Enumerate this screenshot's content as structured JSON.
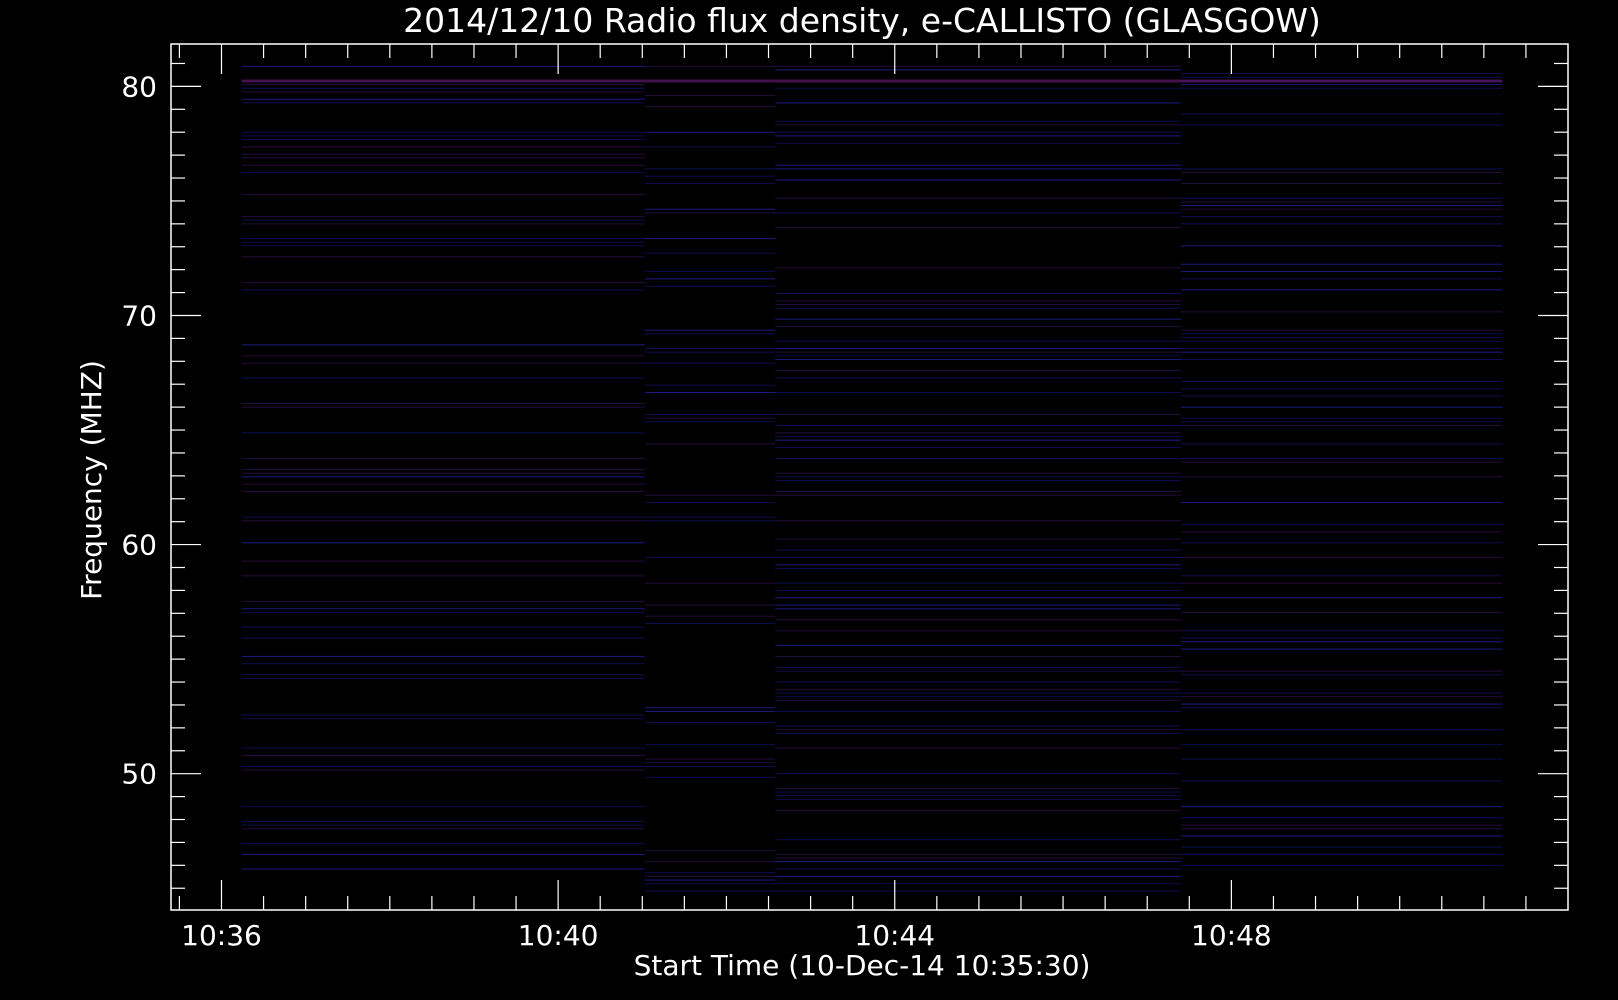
{
  "chart_data": {
    "type": "heatmap",
    "title": "2014/12/10  Radio flux density, e-CALLISTO (GLASGOW)",
    "xlabel": "Start Time (10-Dec-14 10:35:30)",
    "ylabel": "Frequency (MHZ)",
    "x_unit": "minutes after 10:35:30",
    "xlim": [
      -0.1,
      16.5
    ],
    "ylim": [
      81.85,
      44.05
    ],
    "data_xlim": [
      0.74,
      15.72
    ],
    "data_ylim": [
      44.9,
      80.95
    ],
    "x_ticks": [
      {
        "label": "10:36",
        "value": 0.5
      },
      {
        "label": "10:40",
        "value": 4.5
      },
      {
        "label": "10:44",
        "value": 8.5
      },
      {
        "label": "10:48",
        "value": 12.5
      }
    ],
    "y_ticks": [
      {
        "label": "50",
        "value": 50
      },
      {
        "label": "60",
        "value": 60
      },
      {
        "label": "70",
        "value": 70
      },
      {
        "label": "80",
        "value": 80
      }
    ],
    "colors": {
      "background": "#000000",
      "base": "#2828f4",
      "low": "#0a0a6e",
      "medium": "#8a1f6a",
      "high": "#e81f1f",
      "very_high": "#ffe040",
      "saturated": "#ffffb0"
    },
    "segments": [
      {
        "start": 0.74,
        "end": 5.53,
        "base": "#2b2bf2",
        "bands": [
          {
            "f": 45.2,
            "w": 0.45,
            "c": "#e82010"
          },
          {
            "f": 47.4,
            "w": 0.5,
            "c": "#d82020",
            "pulsed": true
          },
          {
            "f": 48.0,
            "w": 0.7,
            "c": "#000000"
          },
          {
            "f": 48.8,
            "w": 0.35,
            "c": "#ffffb0"
          },
          {
            "f": 49.35,
            "w": 0.3,
            "c": "#000000"
          },
          {
            "f": 49.7,
            "w": 0.5,
            "c": "#ffe040",
            "pulsed": true
          },
          {
            "f": 50.6,
            "w": 0.3,
            "c": "#c81c2c"
          },
          {
            "f": 51.5,
            "w": 0.45,
            "c": "#e81f1f"
          },
          {
            "f": 52.6,
            "w": 0.35,
            "c": "#d21f24"
          },
          {
            "f": 53.6,
            "w": 0.3,
            "c": "#7a1f6a"
          },
          {
            "f": 56.5,
            "w": 0.25,
            "c": "#6a1f7a"
          },
          {
            "f": 58.9,
            "w": 0.4,
            "c": "#10105a"
          },
          {
            "f": 59.4,
            "w": 0.4,
            "c": "#c81c28"
          },
          {
            "f": 63.9,
            "w": 0.3,
            "c": "#0a0a6e"
          },
          {
            "f": 64.3,
            "w": 0.35,
            "c": "#8a1f5a"
          },
          {
            "f": 67.6,
            "w": 0.25,
            "c": "#10105a"
          },
          {
            "f": 68.2,
            "w": 0.4,
            "c": "#8a1f5a"
          },
          {
            "f": 71.7,
            "w": 0.3,
            "c": "#7a1f6a"
          },
          {
            "f": 73.9,
            "w": 0.4,
            "c": "#8a1f5a"
          },
          {
            "f": 77.5,
            "w": 0.35,
            "c": "#3a1f9a"
          }
        ]
      },
      {
        "start": 5.53,
        "end": 7.08,
        "base": "#2b2bf2",
        "bands": [
          {
            "f": 45.2,
            "w": 0.4,
            "c": "#b01c3c"
          },
          {
            "f": 46.5,
            "w": 0.3,
            "c": "#10105a"
          },
          {
            "f": 47.6,
            "w": 0.8,
            "c": "#000000"
          },
          {
            "f": 48.7,
            "w": 0.3,
            "c": "#f0d060"
          },
          {
            "f": 49.7,
            "w": 0.35,
            "c": "#7a1f6a"
          },
          {
            "f": 52.0,
            "w": 0.45,
            "c": "#000000"
          },
          {
            "f": 52.6,
            "w": 0.35,
            "c": "#e81f1f"
          },
          {
            "f": 58.7,
            "w": 0.35,
            "c": "#10105a"
          },
          {
            "f": 59.2,
            "w": 0.3,
            "c": "#a01c3c"
          },
          {
            "f": 63.8,
            "w": 0.3,
            "c": "#10105a"
          },
          {
            "f": 67.8,
            "w": 0.3,
            "c": "#10105a"
          },
          {
            "f": 68.4,
            "w": 0.4,
            "c": "#8a1f5a"
          },
          {
            "f": 72.1,
            "w": 0.35,
            "c": "#7a1f6a"
          },
          {
            "f": 73.7,
            "w": 0.4,
            "c": "#8a1f5a"
          }
        ]
      },
      {
        "start": 7.08,
        "end": 11.9,
        "base": "#2525ee",
        "bands": [
          {
            "f": 47.3,
            "w": 0.5,
            "c": "#f0c040",
            "pulsed": true
          },
          {
            "f": 47.9,
            "w": 0.5,
            "c": "#000000"
          },
          {
            "f": 48.9,
            "w": 0.4,
            "c": "#000000"
          },
          {
            "f": 49.3,
            "w": 0.5,
            "c": "#f0c040",
            "pulsed": true
          },
          {
            "f": 68.5,
            "w": 0.3,
            "c": "#4a1f9a"
          },
          {
            "f": 73.5,
            "w": 0.4,
            "c": "#6a1f7a"
          }
        ]
      },
      {
        "start": 11.9,
        "end": 15.72,
        "base": "#2b2bf2",
        "bands": [
          {
            "f": 45.3,
            "w": 0.35,
            "c": "#1a1a8a"
          },
          {
            "f": 47.0,
            "w": 0.4,
            "c": "#e8c040",
            "pulsed": true
          },
          {
            "f": 47.55,
            "w": 0.3,
            "c": "#000000"
          },
          {
            "f": 48.0,
            "w": 0.4,
            "c": "#ffb020"
          },
          {
            "f": 48.5,
            "w": 0.3,
            "c": "#000000"
          },
          {
            "f": 49.3,
            "w": 0.4,
            "c": "#d02020",
            "pulsed": true
          },
          {
            "f": 50.6,
            "w": 0.25,
            "c": "#c81c2c"
          },
          {
            "f": 51.4,
            "w": 0.35,
            "c": "#000000"
          },
          {
            "f": 52.0,
            "w": 0.25,
            "c": "#c8b040"
          },
          {
            "f": 52.35,
            "w": 0.3,
            "c": "#000000"
          },
          {
            "f": 53.7,
            "w": 0.3,
            "c": "#7a1f6a"
          },
          {
            "f": 58.6,
            "w": 0.3,
            "c": "#a01c3c"
          },
          {
            "f": 58.9,
            "w": 0.3,
            "c": "#10105a"
          },
          {
            "f": 63.7,
            "w": 0.35,
            "c": "#a01c3c"
          },
          {
            "f": 67.6,
            "w": 0.4,
            "c": "#8a1f5a"
          },
          {
            "f": 73.3,
            "w": 0.4,
            "c": "#8a1f5a"
          }
        ]
      }
    ]
  }
}
